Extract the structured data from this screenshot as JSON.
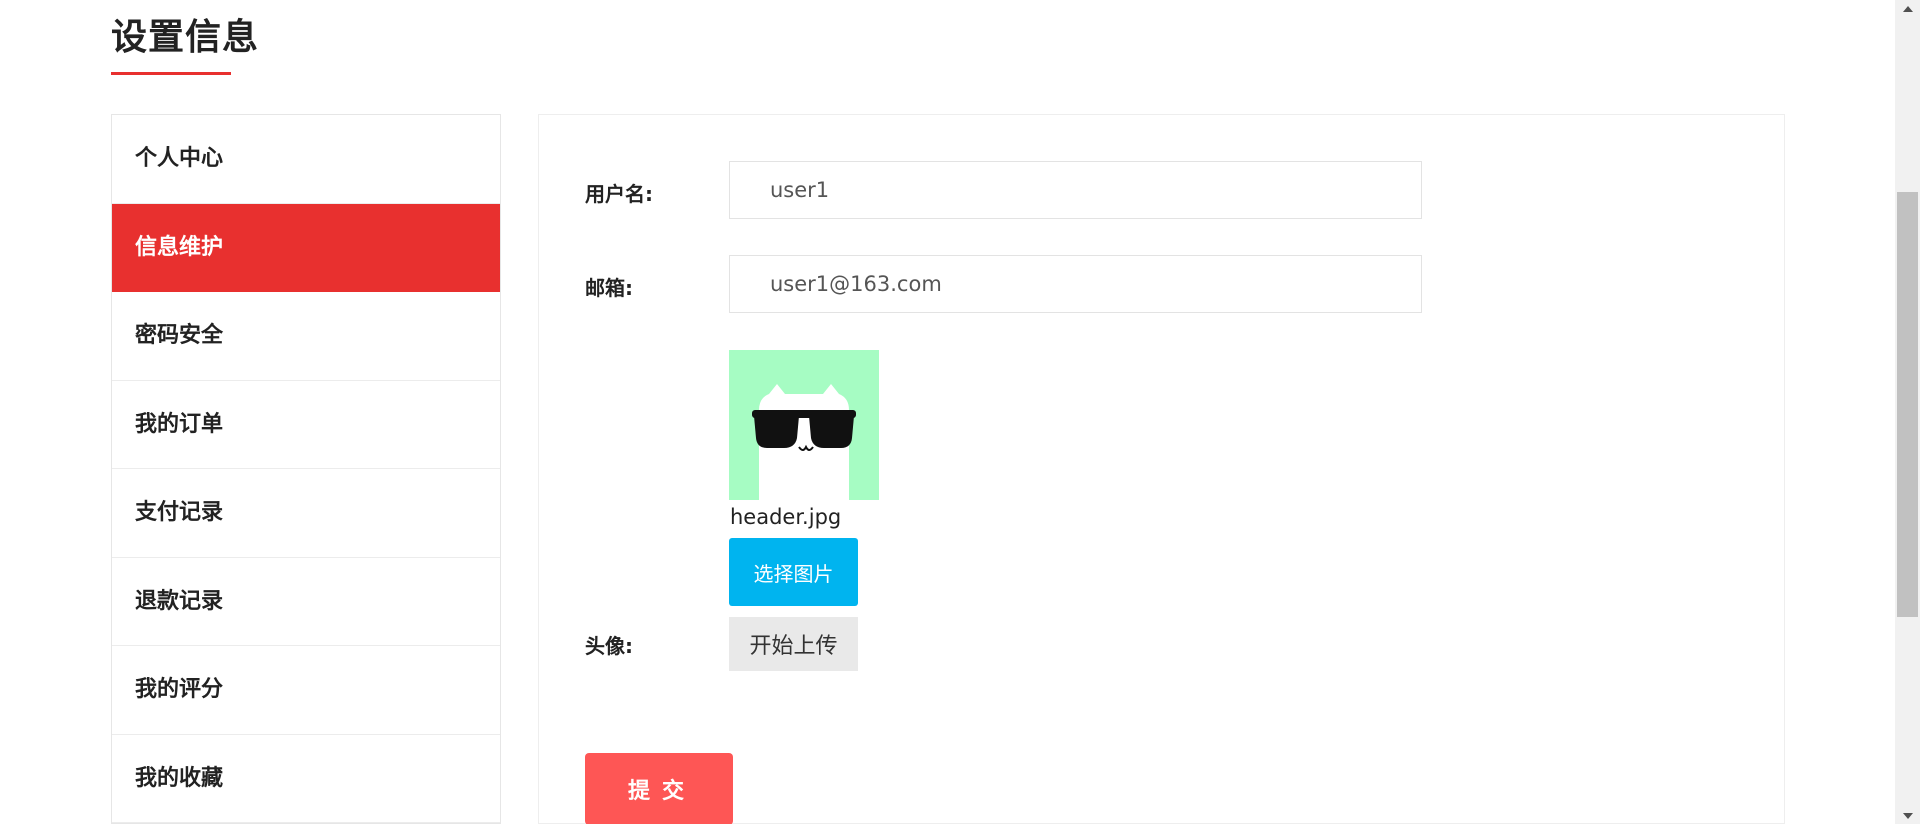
{
  "page": {
    "title": "设置信息"
  },
  "sidebar": {
    "items": [
      {
        "label": "个人中心",
        "active": false
      },
      {
        "label": "信息维护",
        "active": true
      },
      {
        "label": "密码安全",
        "active": false
      },
      {
        "label": "我的订单",
        "active": false
      },
      {
        "label": "支付记录",
        "active": false
      },
      {
        "label": "退款记录",
        "active": false
      },
      {
        "label": "我的评分",
        "active": false
      },
      {
        "label": "我的收藏",
        "active": false
      }
    ]
  },
  "form": {
    "username_label": "用户名:",
    "username_value": "user1",
    "email_label": "邮箱:",
    "email_value": "user1@163.com",
    "avatar_label": "头像:",
    "avatar_file_name": "header.jpg",
    "choose_image_label": "选择图片",
    "start_upload_label": "开始上传",
    "submit_label": "提交"
  },
  "colors": {
    "accent": "#e8302f",
    "submit": "#fe5655",
    "choose_button": "#00b4ef",
    "upload_button": "#e9e9e9",
    "avatar_background": "#a6fcc3"
  },
  "icons": {
    "scroll_up": "chevron-up-icon",
    "scroll_down": "chevron-down-icon",
    "avatar": "cat-with-sunglasses"
  }
}
